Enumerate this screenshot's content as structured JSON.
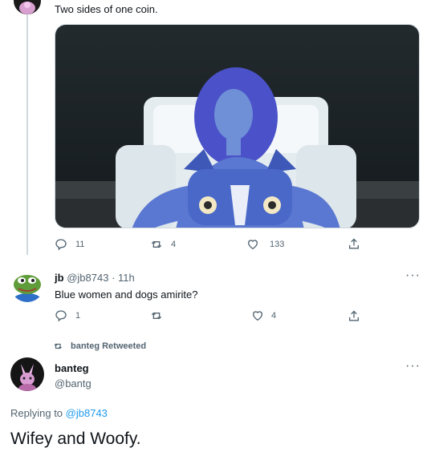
{
  "tweet1": {
    "text": "Two sides of one coin.",
    "replies": "11",
    "retweets": "4",
    "likes": "133"
  },
  "reply": {
    "name": "jb",
    "handle": "@jb8743",
    "separator": "·",
    "time": "11h",
    "text": "Blue women and dogs amirite?",
    "replies": "1",
    "retweets": "",
    "likes": "4"
  },
  "retweet_notice": "banteg Retweeted",
  "main": {
    "name": "banteg",
    "handle": "@bantg",
    "replying_prefix": "Replying to",
    "replying_handle": "@jb8743",
    "text": "Wifey and Woofy."
  },
  "icons": {
    "reply": "reply-icon",
    "retweet": "retweet-icon",
    "like": "heart-icon",
    "share": "share-icon",
    "more": "more-options-icon"
  },
  "colors": {
    "link": "#1d9bf0",
    "muted": "#536471",
    "text": "#0f1419",
    "line": "#cfd9de"
  }
}
